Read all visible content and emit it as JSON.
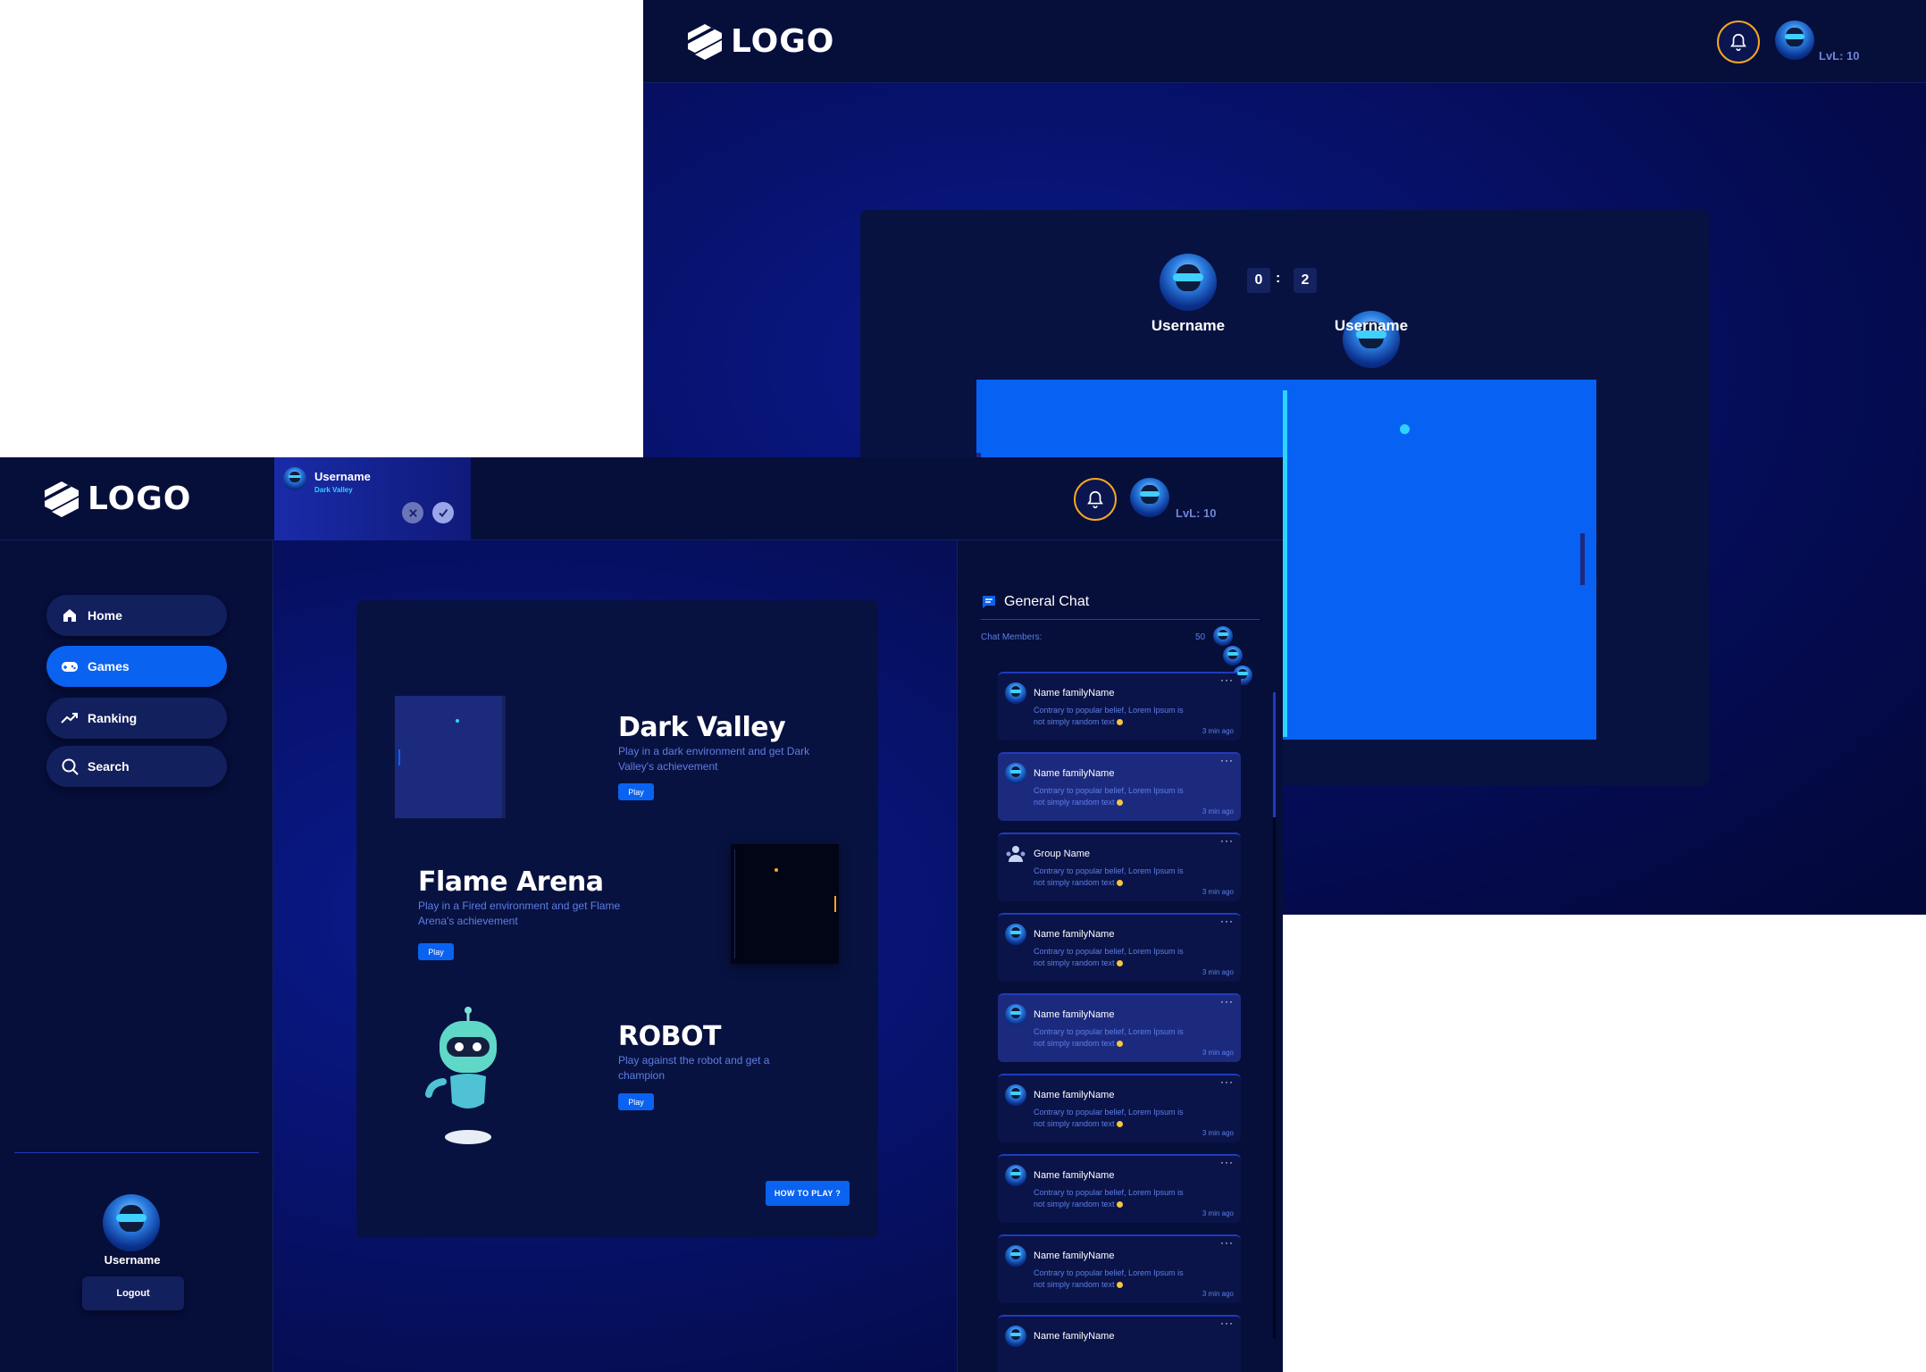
{
  "back_window": {
    "logo_text": "LOGO",
    "level": "LvL: 10",
    "player_left": "Username",
    "player_right": "Username",
    "score_left": "0",
    "score_separator": ":",
    "score_right": "2"
  },
  "front_window": {
    "logo_text": "LOGO",
    "level": "LvL: 10",
    "invite": {
      "username": "Username",
      "game": "Dark Valley"
    },
    "sidebar": {
      "items": [
        {
          "label": "Home",
          "icon": "home-icon"
        },
        {
          "label": "Games",
          "icon": "gamepad-icon"
        },
        {
          "label": "Ranking",
          "icon": "trending-up-icon"
        },
        {
          "label": "Search",
          "icon": "search-icon"
        }
      ],
      "username": "Username",
      "logout": "Logout"
    },
    "games": [
      {
        "title": "Dark Valley",
        "desc": "Play in a dark environment and get Dark Valley's achievement",
        "play": "Play"
      },
      {
        "title": "Flame Arena",
        "desc": "Play in a Fired environment and get Flame Arena's achievement",
        "play": "Play"
      },
      {
        "title": "ROBOT",
        "desc": "Play against the robot and get a champion",
        "play": "Play"
      }
    ],
    "how_to_play": "HOW TO PLAY ?",
    "chat": {
      "title": "General Chat",
      "members_label": "Chat Members:",
      "members_count": "50",
      "messages": [
        {
          "name": "Name familyName",
          "text": "Contrary to popular belief, Lorem Ipsum is not simply random text",
          "time": "3 min ago"
        },
        {
          "name": "Name familyName",
          "text": "Contrary to popular belief, Lorem Ipsum is not simply random text",
          "time": "3 min ago"
        },
        {
          "name": "Group Name",
          "text": "Contrary to popular belief, Lorem Ipsum is not simply random text",
          "time": "3 min ago"
        },
        {
          "name": "Name familyName",
          "text": "Contrary to popular belief, Lorem Ipsum is not simply random text",
          "time": "3 min ago"
        },
        {
          "name": "Name familyName",
          "text": "Contrary to popular belief, Lorem Ipsum is not simply random text",
          "time": "3 min ago"
        },
        {
          "name": "Name familyName",
          "text": "Contrary to popular belief, Lorem Ipsum is not simply random text",
          "time": "3 min ago"
        },
        {
          "name": "Name familyName",
          "text": "Contrary to popular belief, Lorem Ipsum is not simply random text",
          "time": "3 min ago"
        },
        {
          "name": "Name familyName",
          "text": "Contrary to popular belief, Lorem Ipsum is not simply random text",
          "time": "3 min ago"
        },
        {
          "name": "Name familyName",
          "text": "",
          "time": ""
        }
      ]
    }
  },
  "colors": {
    "accent": "#0a62f0",
    "bell_ring": "#f5a623",
    "panel": "#060e3a",
    "card": "#081240",
    "muted_text": "#5d7ee6",
    "ball": "#2fd3ff"
  }
}
